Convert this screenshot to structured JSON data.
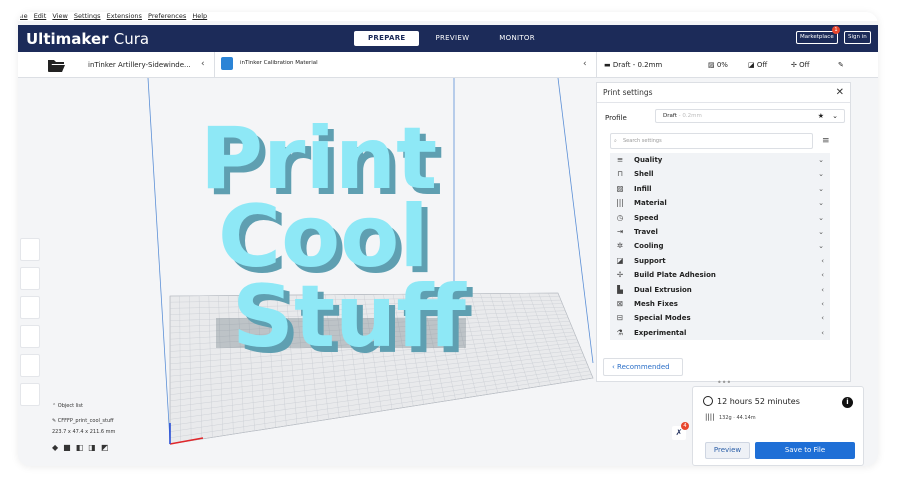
{
  "menu": [
    "File",
    "Edit",
    "View",
    "Settings",
    "Extensions",
    "Preferences",
    "Help"
  ],
  "menu_display": [
    "ile",
    "Edit",
    "View",
    "Settings",
    "Extensions",
    "Preferences",
    "Help"
  ],
  "app": {
    "brand_bold": "Ultimaker",
    "brand_light": "Cura"
  },
  "tabs": [
    "PREPARE",
    "PREVIEW",
    "MONITOR"
  ],
  "top_buttons": {
    "marketplace": "Marketplace",
    "signin": "Sign in",
    "badge": "1"
  },
  "subbar": {
    "machine": "inTinker Artillery-Sidewinde...",
    "material": "inTinker Calibration Material",
    "profile": "Draft - 0.2mm",
    "infill": "0%",
    "support": "Off",
    "adhesion": "Off"
  },
  "model_text": [
    "Print",
    "Cool",
    "Stuff"
  ],
  "panel": {
    "title": "Print settings",
    "profile_label": "Profile",
    "profile_value": "Draft",
    "profile_dim": "- 0.2mm",
    "search_placeholder": "Search settings",
    "categories": [
      {
        "label": "Quality",
        "icon": "quality-icon",
        "glyph": "≡",
        "expanded": true
      },
      {
        "label": "Shell",
        "icon": "shell-icon",
        "glyph": "⊓",
        "expanded": true
      },
      {
        "label": "Infill",
        "icon": "infill-icon",
        "glyph": "▨",
        "expanded": true
      },
      {
        "label": "Material",
        "icon": "material-icon",
        "glyph": "|||",
        "expanded": true
      },
      {
        "label": "Speed",
        "icon": "speed-icon",
        "glyph": "◷",
        "expanded": true
      },
      {
        "label": "Travel",
        "icon": "travel-icon",
        "glyph": "⇥",
        "expanded": true
      },
      {
        "label": "Cooling",
        "icon": "cooling-icon",
        "glyph": "✲",
        "expanded": true
      },
      {
        "label": "Support",
        "icon": "support-icon",
        "glyph": "◪",
        "expanded": false
      },
      {
        "label": "Build Plate Adhesion",
        "icon": "adhesion-icon",
        "glyph": "✢",
        "expanded": false
      },
      {
        "label": "Dual Extrusion",
        "icon": "dual-extrusion-icon",
        "glyph": "▙",
        "expanded": false
      },
      {
        "label": "Mesh Fixes",
        "icon": "mesh-fixes-icon",
        "glyph": "⊠",
        "expanded": false
      },
      {
        "label": "Special Modes",
        "icon": "special-modes-icon",
        "glyph": "⊟",
        "expanded": false
      },
      {
        "label": "Experimental",
        "icon": "experimental-icon",
        "glyph": "⚗",
        "expanded": false
      }
    ],
    "recommended": "Recommended"
  },
  "objects": {
    "header": "Object list",
    "name": "CFFFP_print_cool_stuff",
    "dims": "223.7 x 47.4 x 211.6 mm"
  },
  "estimate": {
    "time": "12 hours 52 minutes",
    "material": "132g · 44.14m",
    "preview": "Preview",
    "save": "Save to File",
    "extruder_badge": "4"
  },
  "colors": {
    "brand": "#1c2b59",
    "accent": "#1f6fd6",
    "model": "#8ee8f6",
    "model_side": "#5fa6b8"
  }
}
